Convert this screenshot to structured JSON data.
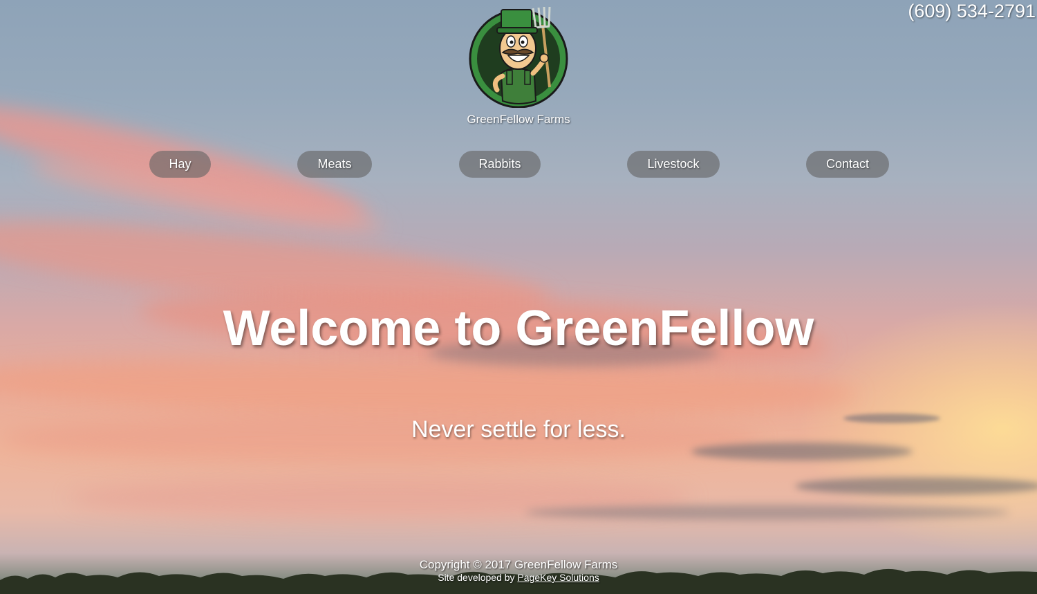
{
  "header": {
    "phone": "(609) 534-2791",
    "brand_name": "GreenFellow Farms",
    "logo_icon": "farmer-with-pitchfork-logo"
  },
  "nav": {
    "items": [
      {
        "label": "Hay"
      },
      {
        "label": "Meats"
      },
      {
        "label": "Rabbits"
      },
      {
        "label": "Livestock"
      },
      {
        "label": "Contact"
      }
    ]
  },
  "hero": {
    "headline": "Welcome to GreenFellow",
    "tagline": "Never settle for less."
  },
  "footer": {
    "copyright": "Copyright © 2017 GreenFellow Farms",
    "credit_prefix": "Site developed by",
    "credit_link": "PageKey Solutions"
  },
  "colors": {
    "logo_green": "#3a8f3f",
    "logo_dark": "#1f3d1f",
    "nav_pill": "#646464"
  }
}
